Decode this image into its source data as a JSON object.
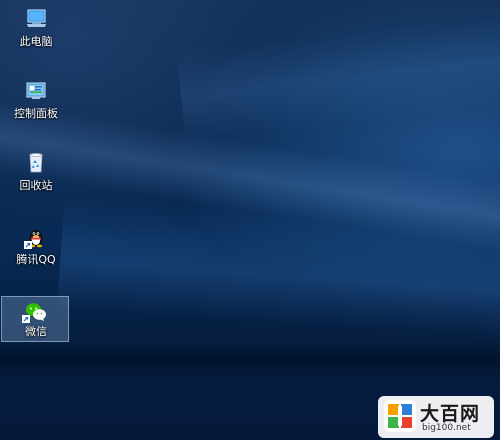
{
  "desktop": {
    "icons": [
      {
        "label": "此电脑",
        "icon": "computer-icon"
      },
      {
        "label": "控制面板",
        "icon": "control-panel-icon"
      },
      {
        "label": "回收站",
        "icon": "recycle-bin-icon"
      },
      {
        "label": "腾讯QQ",
        "icon": "qq-penguin-icon",
        "shortcut": true
      },
      {
        "label": "微信",
        "icon": "wechat-icon",
        "shortcut": true,
        "selected": true
      }
    ]
  },
  "watermark": {
    "title": "大百网",
    "url": "big100.net"
  },
  "colors": {
    "wallpaper": "#082a55",
    "selection": "#8cafd7",
    "wechat_green": "#2dc100"
  }
}
